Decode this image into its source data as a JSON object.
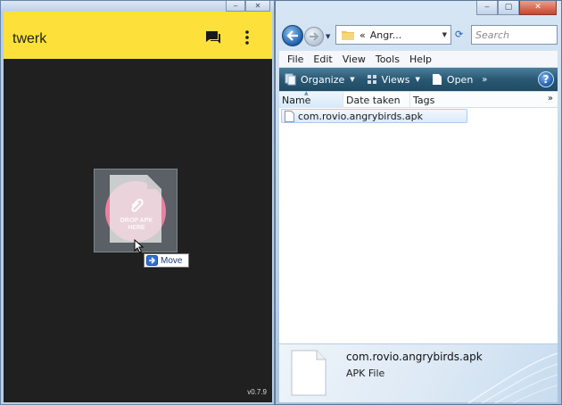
{
  "left_window": {
    "caption": {
      "minimize": "‒",
      "close": "✕"
    },
    "app": {
      "title": "twerk",
      "drop_zone_label_line1": "DROP APK",
      "drop_zone_label_line2": "HERE",
      "version": "v0.7.9",
      "accent_color": "#fde13a",
      "drop_circle_color": "#e9829f"
    },
    "drag_tooltip": {
      "label": "Move"
    }
  },
  "right_window": {
    "caption": {
      "minimize": "‒",
      "maximize": "▢",
      "close": "✕"
    },
    "navigation": {
      "breadcrumb_prefix": "«",
      "breadcrumb_current": "Angr...",
      "search_placeholder": "Search"
    },
    "menu": [
      "File",
      "Edit",
      "View",
      "Tools",
      "Help"
    ],
    "toolbar": {
      "organize": "Organize",
      "views": "Views",
      "open": "Open",
      "more": "»",
      "help": "?"
    },
    "columns": {
      "name": "Name",
      "date_taken": "Date taken",
      "tags": "Tags",
      "more": "»"
    },
    "files": [
      {
        "name": "com.rovio.angrybirds.apk"
      }
    ],
    "details_pane": {
      "file_name": "com.rovio.angrybirds.apk",
      "file_type": "APK File"
    }
  }
}
